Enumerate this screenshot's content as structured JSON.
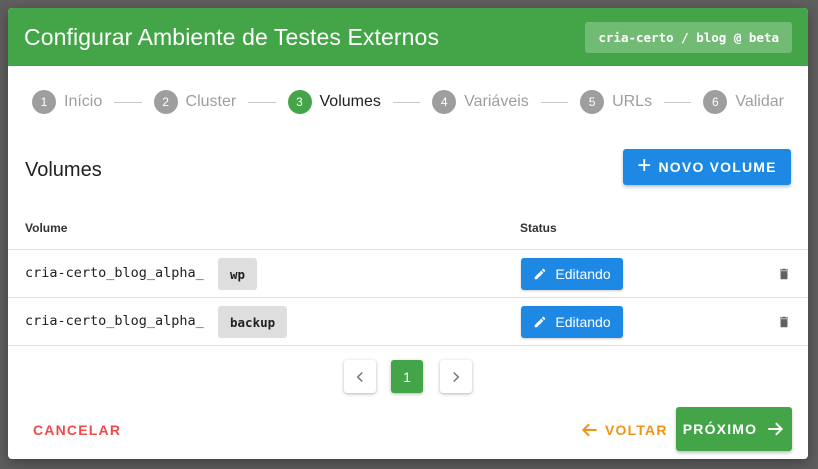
{
  "dialog": {
    "title": "Configurar Ambiente de Testes Externos",
    "badge": "cria-certo / blog @ beta"
  },
  "stepper": {
    "steps": [
      {
        "number": "1",
        "label": "Início",
        "active": false
      },
      {
        "number": "2",
        "label": "Cluster",
        "active": false
      },
      {
        "number": "3",
        "label": "Volumes",
        "active": true
      },
      {
        "number": "4",
        "label": "Variáveis",
        "active": false
      },
      {
        "number": "5",
        "label": "URLs",
        "active": false
      },
      {
        "number": "6",
        "label": "Validar",
        "active": false
      }
    ]
  },
  "volumes": {
    "title": "Volumes",
    "new_button_label": "NOVO VOLUME",
    "columns": {
      "volume": "Volume",
      "status": "Status"
    },
    "rows": [
      {
        "prefix": "cria-certo_blog_alpha_",
        "suffix": "wp",
        "status": "Editando",
        "actions": [
          "edit-icon",
          "trash-icon"
        ]
      },
      {
        "prefix": "cria-certo_blog_alpha_",
        "suffix": "backup",
        "status": "Editando",
        "actions": [
          "edit-icon",
          "trash-icon"
        ]
      }
    ]
  },
  "pagination": {
    "current_page": "1",
    "prev_icon": "chevron-left-icon",
    "next_icon": "chevron-right-icon"
  },
  "footer": {
    "cancel_label": "CANCELAR",
    "back_label": "VOLTAR",
    "next_label": "PRÓXIMO"
  },
  "colors": {
    "header": "#43a547",
    "primary_blue": "#1e88e5",
    "cancel_red": "#f04b4b",
    "back_orange": "#f39217",
    "step_inactive": "#9e9e9e"
  }
}
